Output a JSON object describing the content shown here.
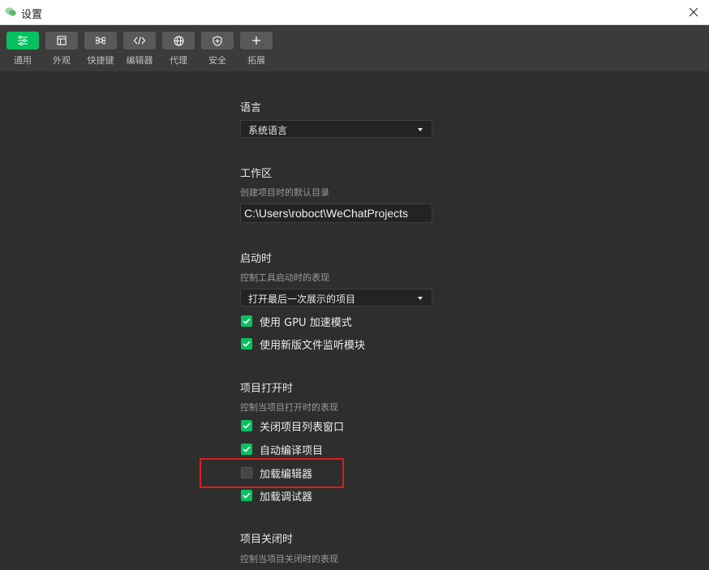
{
  "window": {
    "title": "设置"
  },
  "toolbar": {
    "items": [
      {
        "label": "通用",
        "icon": "sliders-icon",
        "active": true
      },
      {
        "label": "外观",
        "icon": "window-icon",
        "active": false
      },
      {
        "label": "快捷键",
        "icon": "command-key-icon",
        "active": false
      },
      {
        "label": "编辑器",
        "icon": "code-icon",
        "active": false
      },
      {
        "label": "代理",
        "icon": "globe-icon",
        "active": false
      },
      {
        "label": "安全",
        "icon": "shield-icon",
        "active": false
      },
      {
        "label": "拓展",
        "icon": "plus-icon",
        "active": false
      }
    ]
  },
  "language": {
    "title": "语言",
    "selected": "系统语言"
  },
  "workspace": {
    "title": "工作区",
    "desc": "创建项目时的默认目录",
    "path": "C:\\Users\\roboct\\WeChatProjects"
  },
  "startup": {
    "title": "启动时",
    "desc": "控制工具启动时的表现",
    "selected": "打开最后一次展示的项目",
    "options": [
      {
        "label": "使用 GPU 加速模式",
        "checked": true
      },
      {
        "label": "使用新版文件监听模块",
        "checked": true
      }
    ]
  },
  "project_open": {
    "title": "项目打开时",
    "desc": "控制当项目打开时的表现",
    "options": [
      {
        "label": "关闭项目列表窗口",
        "checked": true
      },
      {
        "label": "自动编译项目",
        "checked": true
      },
      {
        "label": "加载编辑器",
        "checked": false
      },
      {
        "label": "加载调试器",
        "checked": true
      }
    ]
  },
  "project_close": {
    "title": "项目关闭时",
    "desc": "控制当项目关闭时的表现"
  },
  "colors": {
    "accent": "#07c160",
    "highlight": "#d9201c",
    "background": "#2e2e2e",
    "toolbar": "#3b3b3b"
  }
}
